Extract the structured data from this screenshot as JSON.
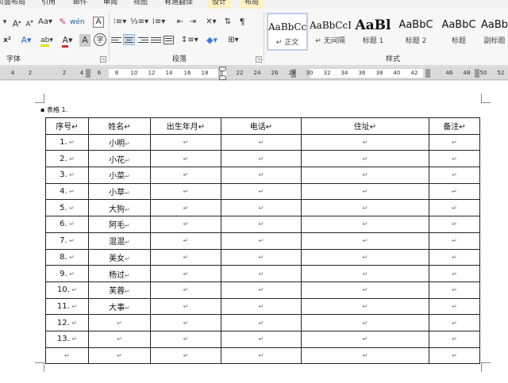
{
  "tabs": [
    "页面布局",
    "引用",
    "邮件",
    "审阅",
    "视图",
    "有道翻译",
    "设计",
    "布局"
  ],
  "font_group": {
    "label": "字体",
    "row1_icons": [
      "font-size-dropdown",
      "grow-font-icon",
      "shrink-font-icon",
      "change-case-icon",
      "clear-format-icon",
      "phonetic-guide-icon",
      "char-border-icon"
    ],
    "row2": {
      "superscript": "x²",
      "effects": "A",
      "highlight": "ab",
      "fontcolor": "A",
      "shade": "A",
      "circle": "字"
    }
  },
  "paragraph_group": {
    "label": "段落"
  },
  "styles_group": {
    "label": "样式",
    "items": [
      {
        "preview": "AaBbCcI",
        "name": "正文",
        "prefix": "↵"
      },
      {
        "preview": "AaBbCcI",
        "name": "无间隔",
        "prefix": "↵"
      },
      {
        "preview": "AaBl",
        "name": "标题 1"
      },
      {
        "preview": "AaBbC",
        "name": "标题 2"
      },
      {
        "preview": "AaBbC",
        "name": "标题"
      },
      {
        "preview": "AaBb",
        "name": "副标题"
      }
    ]
  },
  "ruler": {
    "labels": [
      "4",
      "2",
      "",
      "2",
      "4",
      "6",
      "8",
      "10",
      "12",
      "14",
      "16",
      "18",
      "",
      "22",
      "24",
      "26",
      "28",
      "30",
      "32",
      "34",
      "36",
      "38",
      "40",
      "42",
      "",
      "46",
      "48",
      "50",
      "52"
    ]
  },
  "document": {
    "caption": "表格 1.",
    "paragraph_mark": "↵",
    "headers": [
      "序号↵",
      "姓名↵",
      "出生年月↵",
      "电话↵",
      "住址↵",
      "备注↵"
    ],
    "rows": [
      [
        "1.",
        "小明"
      ],
      [
        "2.",
        "小花"
      ],
      [
        "3.",
        "小菜"
      ],
      [
        "4.",
        "小草"
      ],
      [
        "5.",
        "大狗"
      ],
      [
        "6.",
        "阿毛"
      ],
      [
        "7.",
        "混混"
      ],
      [
        "8.",
        "美女"
      ],
      [
        "9.",
        "杨过"
      ],
      [
        "10.",
        "芙蓉"
      ],
      [
        "11.",
        "大事"
      ],
      [
        "12.",
        ""
      ],
      [
        "13.",
        ""
      ],
      [
        "",
        ""
      ]
    ]
  },
  "colors": {
    "accent": "#fdf0c4",
    "highlight": "#e8e000",
    "fontcolor": "#d42a2a"
  }
}
